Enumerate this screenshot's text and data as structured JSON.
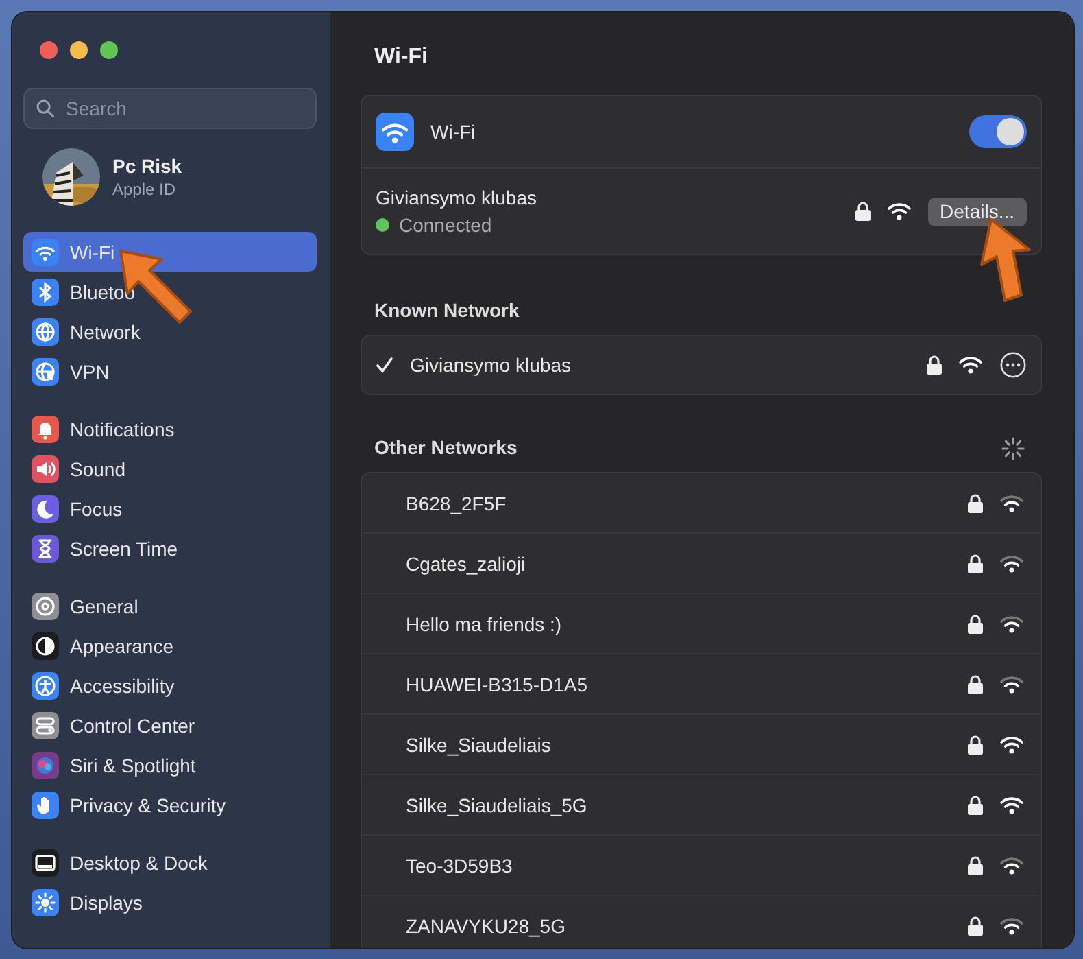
{
  "window": {
    "title": "Wi-Fi"
  },
  "search": {
    "placeholder": "Search"
  },
  "account": {
    "name": "Pc Risk",
    "subtitle": "Apple ID"
  },
  "sidebar": {
    "groups": [
      {
        "items": [
          {
            "label": "Wi-Fi",
            "color": "#3b82f6",
            "selected": true
          },
          {
            "label": "Bluetoo",
            "color": "#3b82f6",
            "selected": false
          },
          {
            "label": "Network",
            "color": "#3b82f6",
            "selected": false
          },
          {
            "label": "VPN",
            "color": "#3b82f6",
            "selected": false
          }
        ]
      },
      {
        "items": [
          {
            "label": "Notifications",
            "color": "#e8584a",
            "selected": false
          },
          {
            "label": "Sound",
            "color": "#e05260",
            "selected": false
          },
          {
            "label": "Focus",
            "color": "#6b5fe0",
            "selected": false
          },
          {
            "label": "Screen Time",
            "color": "#6a58d8",
            "selected": false
          }
        ]
      },
      {
        "items": [
          {
            "label": "General",
            "color": "#8e8e93",
            "selected": false
          },
          {
            "label": "Appearance",
            "color": "#1c1c1e",
            "selected": false
          },
          {
            "label": "Accessibility",
            "color": "#3b82f6",
            "selected": false
          },
          {
            "label": "Control Center",
            "color": "#8e8e93",
            "selected": false
          },
          {
            "label": "Siri & Spotlight",
            "color": "#7a3a8a",
            "selected": false
          },
          {
            "label": "Privacy & Security",
            "color": "#3b82f6",
            "selected": false
          }
        ]
      },
      {
        "items": [
          {
            "label": "Desktop & Dock",
            "color": "#1c1c1e",
            "selected": false
          },
          {
            "label": "Displays",
            "color": "#3b82f6",
            "selected": false
          }
        ]
      }
    ]
  },
  "wifi": {
    "label": "Wi-Fi",
    "on": true
  },
  "current": {
    "name": "Giviansymo klubas",
    "status": "Connected",
    "connected": true,
    "locked": true,
    "button": "Details..."
  },
  "known": {
    "heading": "Known Network",
    "networks": [
      {
        "name": "Giviansymo klubas",
        "checked": true,
        "locked": true
      }
    ]
  },
  "other": {
    "heading": "Other Networks",
    "networks": [
      {
        "name": "B628_2F5F",
        "locked": true,
        "strong": false
      },
      {
        "name": "Cgates_zalioji",
        "locked": true,
        "strong": false
      },
      {
        "name": "Hello ma friends :)",
        "locked": true,
        "strong": false
      },
      {
        "name": "HUAWEI-B315-D1A5",
        "locked": true,
        "strong": false
      },
      {
        "name": "Silke_Siaudeliais",
        "locked": true,
        "strong": true
      },
      {
        "name": "Silke_Siaudeliais_5G",
        "locked": true,
        "strong": true
      },
      {
        "name": "Teo-3D59B3",
        "locked": true,
        "strong": false
      },
      {
        "name": "ZANAVYKU28_5G",
        "locked": true,
        "strong": false
      }
    ]
  }
}
